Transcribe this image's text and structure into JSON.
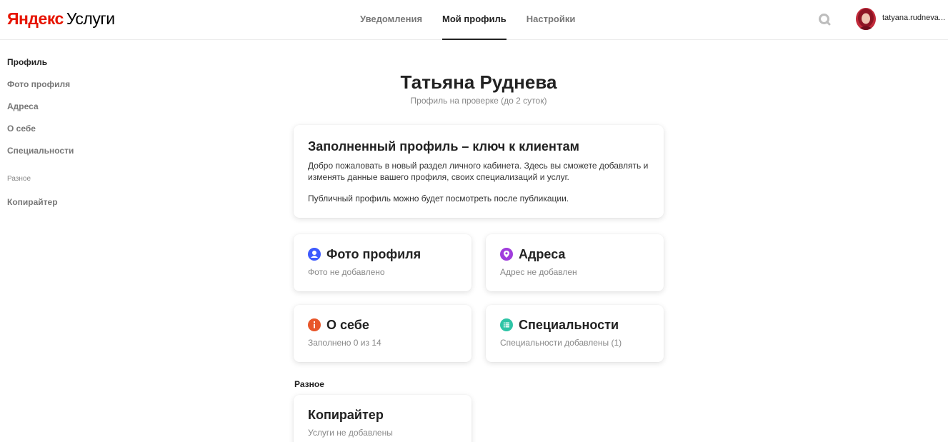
{
  "header": {
    "logo_brand": "Яндекс",
    "logo_service": "Услуги",
    "tabs": [
      {
        "label": "Уведомления"
      },
      {
        "label": "Мой профиль"
      },
      {
        "label": "Настройки"
      }
    ],
    "active_tab": "Мой профиль",
    "username": "tatyana.rudneva..."
  },
  "sidebar": {
    "items": [
      {
        "label": "Профиль"
      },
      {
        "label": "Фото профиля"
      },
      {
        "label": "Адреса"
      },
      {
        "label": "О себе"
      },
      {
        "label": "Специальности"
      }
    ],
    "active_item": "Профиль",
    "section_label": "Разное",
    "section_items": [
      {
        "label": "Копирайтер"
      }
    ]
  },
  "profile": {
    "name": "Татьяна Руднева",
    "status": "Профиль на проверке (до 2 суток)"
  },
  "welcome": {
    "title": "Заполненный профиль – ключ к клиентам",
    "text": "Добро пожаловать в новый раздел личного кабинета. Здесь вы сможете добавлять и изменять данные вашего профиля, своих специализаций и услуг.",
    "note": "Публичный профиль можно будет посмотреть после публикации."
  },
  "tiles": [
    {
      "title": "Фото профиля",
      "subtitle": "Фото не добавлено",
      "icon": "user-icon",
      "color": "#3d5afe"
    },
    {
      "title": "Адреса",
      "subtitle": "Адрес не добавлен",
      "icon": "map-pin-icon",
      "color": "#a03cdc"
    },
    {
      "title": "О себе",
      "subtitle": "Заполнено 0 из 14",
      "icon": "info-icon",
      "color": "#e8562a"
    },
    {
      "title": "Специальности",
      "subtitle": "Специальности добавлены (1)",
      "icon": "list-icon",
      "color": "#2ec4a6"
    }
  ],
  "misc": {
    "label": "Разное",
    "card_title": "Копирайтер",
    "card_subtitle": "Услуги не добавлены"
  },
  "colors": {
    "brand_red": "#e61400",
    "text": "#222222",
    "muted": "#888888"
  }
}
